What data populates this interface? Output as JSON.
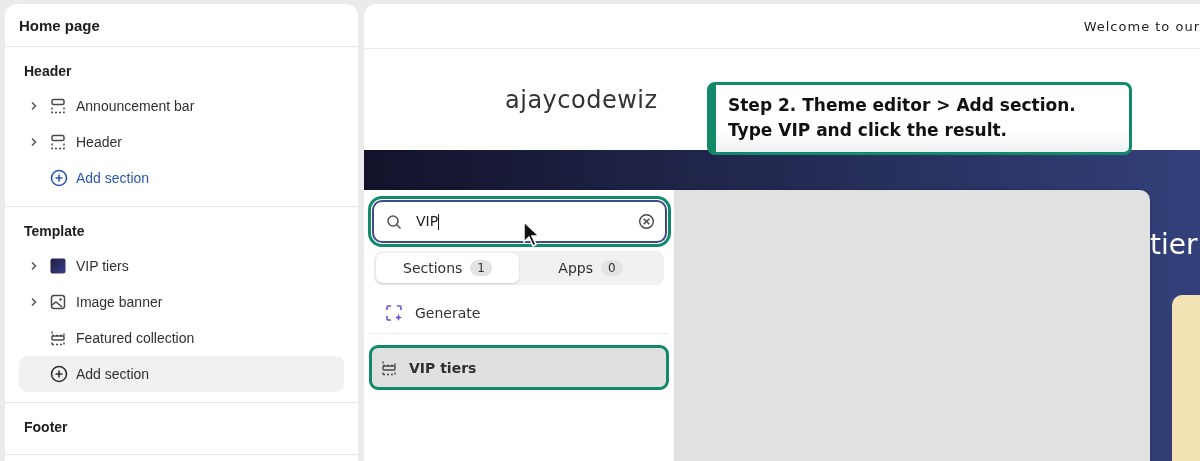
{
  "sidebar": {
    "title": "Home page",
    "groups": [
      {
        "title": "Header",
        "items": [
          {
            "kind": "layout",
            "label": "Announcement bar",
            "expandable": true,
            "selected": false
          },
          {
            "kind": "layout",
            "label": "Header",
            "expandable": true,
            "selected": false
          },
          {
            "kind": "add",
            "label": "Add section",
            "expandable": false,
            "selected": false
          }
        ]
      },
      {
        "title": "Template",
        "items": [
          {
            "kind": "swatch",
            "label": "VIP tiers",
            "expandable": true,
            "selected": false
          },
          {
            "kind": "image",
            "label": "Image banner",
            "expandable": true,
            "selected": false
          },
          {
            "kind": "collection",
            "label": "Featured collection",
            "expandable": false,
            "selected": false
          },
          {
            "kind": "add",
            "label": "Add section",
            "expandable": false,
            "selected": true
          }
        ]
      },
      {
        "title": "Footer"
      }
    ]
  },
  "preview": {
    "announcement": "Welcome to our",
    "logo": "ajaycodewiz",
    "banner_heading": "tier"
  },
  "callout": {
    "text": "Step 2. Theme editor > Add section.\nType VIP and click the result."
  },
  "picker": {
    "search": {
      "value": "VIP",
      "highlighted": true
    },
    "tabs": [
      {
        "label": "Sections",
        "count": "1",
        "selected": true
      },
      {
        "label": "Apps",
        "count": "0",
        "selected": false
      }
    ],
    "results": [
      {
        "kind": "generate",
        "label": "Generate",
        "highlighted": false
      },
      {
        "kind": "section",
        "label": "VIP tiers",
        "highlighted": true
      }
    ]
  }
}
